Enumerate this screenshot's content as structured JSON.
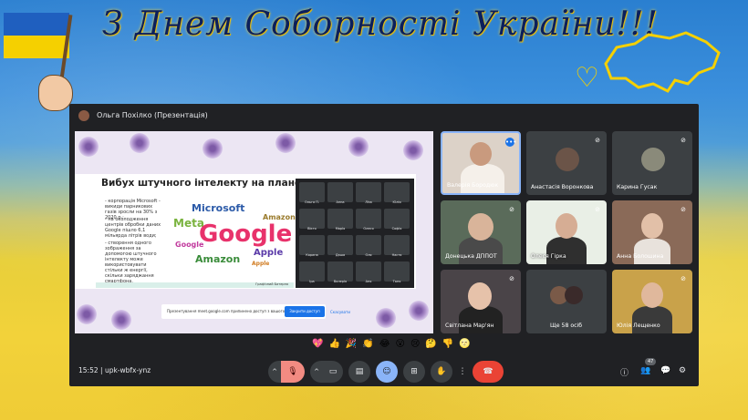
{
  "banner": {
    "title": "З Днем Соборності України!!!"
  },
  "meeting": {
    "presenter_label": "Ольга Похілко (Презентація)",
    "time": "15:52",
    "separator": "|",
    "code": "upk-wbfx-ynz",
    "participant_count": "47"
  },
  "slide": {
    "heading": "Вибух штучного інтелекту на планеті і зміна клім",
    "bullets": [
      "- корпорація Microsoft - викиди парникових газів зросли на 30% з 2020 р.;",
      "- на охолодження центрів обробки даних Google пішло 6,1 мільярда літрів води;",
      "- створення одного зображення за допомогою штучного інтелекту може використовувати стільки ж енергії, скільки заряджання смартфона."
    ],
    "cloud_words": [
      "Google",
      "Microsoft",
      "Amazon",
      "Meta",
      "Apple",
      "Google",
      "Amazon",
      "Apple"
    ],
    "caption": "Графічний Батерня",
    "mini_labels": [
      "Ольга П.",
      "Анна",
      "Ліза",
      "Юлія",
      "Вікто",
      "Марія",
      "Олеся",
      "Софія",
      "Карина",
      "Даша",
      "Оля",
      "Настя",
      "Іра",
      "Валерія",
      "Аня",
      "Таня"
    ],
    "notice_text": "Презентування meet.google.com припинено доступ з вашого екрана",
    "notice_button": "Закрити доступ",
    "notice_close": "Скасувати"
  },
  "participants": [
    {
      "name": "Валерія Бородюк"
    },
    {
      "name": "Анастасія Воронкова"
    },
    {
      "name": "Карина Гусак"
    },
    {
      "name": "Донецька ДППОТ"
    },
    {
      "name": "Олеся Гірка"
    },
    {
      "name": "Анна Болошина"
    },
    {
      "name": "Світлана Мар'ян"
    },
    {
      "name": "Ще 58 осіб"
    },
    {
      "name": "Юлія Лещенко"
    }
  ],
  "reactions": [
    "💖",
    "👍",
    "🎉",
    "👏",
    "😂",
    "😮",
    "😢",
    "🤔",
    "👎",
    "🌝"
  ],
  "colors": {
    "accent": "#1a73e8",
    "end_call": "#ea4335",
    "active": "#8ab4f8",
    "mic_off": "#f28b82"
  }
}
